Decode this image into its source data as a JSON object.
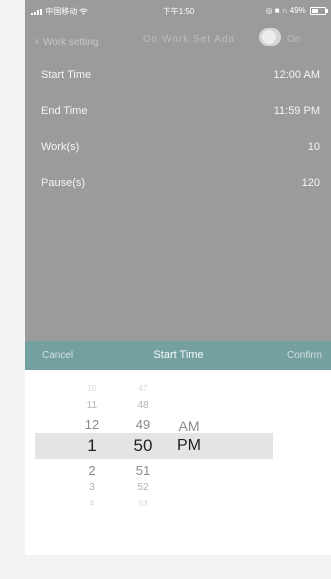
{
  "status_bar": {
    "carrier": "中国移动",
    "time": "下午1:50",
    "battery": "49%"
  },
  "nav": {
    "back_label": "Work setting",
    "middle_text": "On  Work  Set  Ada",
    "right_text": "On"
  },
  "settings": [
    {
      "label": "Start Time",
      "value": "12:00 AM"
    },
    {
      "label": "End Time",
      "value": "11:59 PM"
    },
    {
      "label": "Work(s)",
      "value": "10"
    },
    {
      "label": "Pause(s)",
      "value": "120"
    }
  ],
  "picker": {
    "cancel_label": "Cancel",
    "title": "Start Time",
    "confirm_label": "Confirm",
    "hours": [
      "10",
      "11",
      "12",
      "1",
      "2",
      "3",
      "4"
    ],
    "minutes": [
      "47",
      "48",
      "49",
      "50",
      "51",
      "52",
      "53"
    ],
    "ampm": [
      "AM",
      "PM"
    ]
  },
  "colors": {
    "overlay": "#9b9b9b",
    "picker_header": "#74a09f",
    "page_bg": "#f3f3f3"
  }
}
